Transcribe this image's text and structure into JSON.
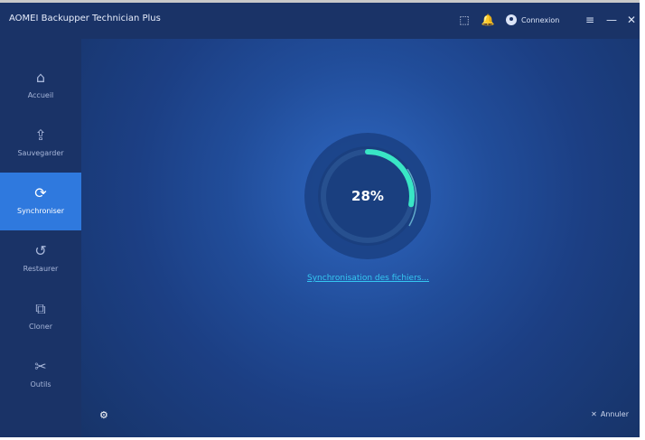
{
  "window": {
    "title": "AOMEI Backupper Technician Plus"
  },
  "titlebar": {
    "icons": [
      "upgrade-icon",
      "bell-icon",
      "user-icon",
      "menu-icon",
      "minimize-icon",
      "close-icon"
    ],
    "login_label": "Connexion"
  },
  "sidebar": {
    "items": [
      {
        "label": "Accueil",
        "icon": "home-icon"
      },
      {
        "label": "Sauvegarder",
        "icon": "backup-icon"
      },
      {
        "label": "Synchroniser",
        "icon": "sync-icon",
        "active": true
      },
      {
        "label": "Restaurer",
        "icon": "restore-icon"
      },
      {
        "label": "Cloner",
        "icon": "clone-icon"
      },
      {
        "label": "Outils",
        "icon": "tools-icon"
      }
    ]
  },
  "main": {
    "progress_text": "28%",
    "progress_value": 0.28,
    "status_text": "Synchronisation des fichiers...",
    "cancel_label": "Annuler"
  },
  "colors": {
    "accent": "#2f79de",
    "progress": "#39e6c5",
    "link": "#35c7f2"
  }
}
